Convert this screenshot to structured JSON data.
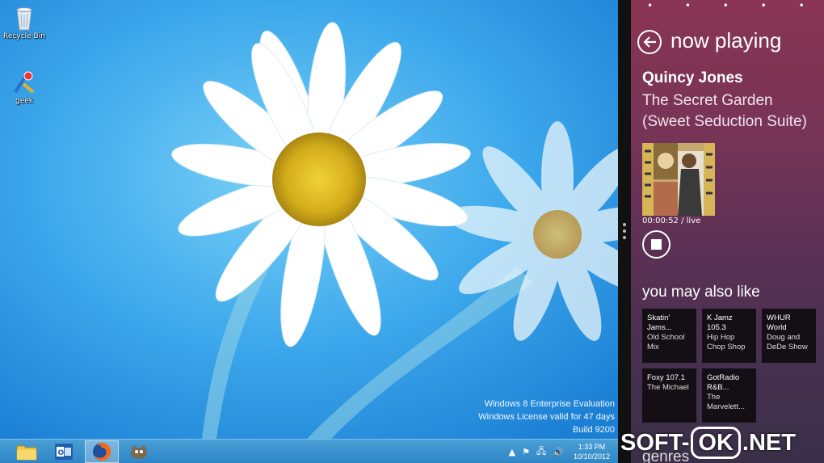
{
  "desktop": {
    "icons": [
      {
        "label": "Recycle Bin",
        "icon": "recycle-bin-icon"
      },
      {
        "label": "geek",
        "icon": "app-shortcut-icon"
      }
    ],
    "watermark": {
      "line1": "Windows 8 Enterprise Evaluation",
      "line2": "Windows License valid for 47 days",
      "line3": "Build 9200"
    }
  },
  "taskbar": {
    "buttons": [
      {
        "name": "file-explorer",
        "icon": "folder-icon"
      },
      {
        "name": "outlook",
        "icon": "outlook-icon"
      },
      {
        "name": "firefox",
        "icon": "firefox-icon",
        "active": true
      },
      {
        "name": "gimp",
        "icon": "gimp-icon"
      }
    ],
    "clock": {
      "time": "1:33 PM",
      "date": "10/10/2012"
    }
  },
  "app": {
    "title": "now playing",
    "artist": "Quincy Jones",
    "track": "The Secret Garden (Sweet Seduction Suite)",
    "position": "00:00:52 /",
    "duration": "live",
    "also_like": "you may also like",
    "stations": [
      {
        "name": "Skatin' Jams...",
        "subtitle": "Old School Mix"
      },
      {
        "name": "K Jamz 105.3",
        "subtitle": "Hip Hop Chop Shop"
      },
      {
        "name": "WHUR World",
        "subtitle": "Doug and DeDe Show"
      },
      {
        "name": "Foxy 107.1",
        "subtitle": "The Michael"
      },
      {
        "name": "GotRadio R&B...",
        "subtitle": "The Marvelett..."
      }
    ],
    "genres": "genres"
  },
  "site_mark": {
    "pre": "SOFT-",
    "ok": "OK",
    "post": ".NET"
  },
  "colors": {
    "taskbar": "#2f86c6",
    "app_top": "#8a3553",
    "app_bottom": "#3a2f48"
  }
}
